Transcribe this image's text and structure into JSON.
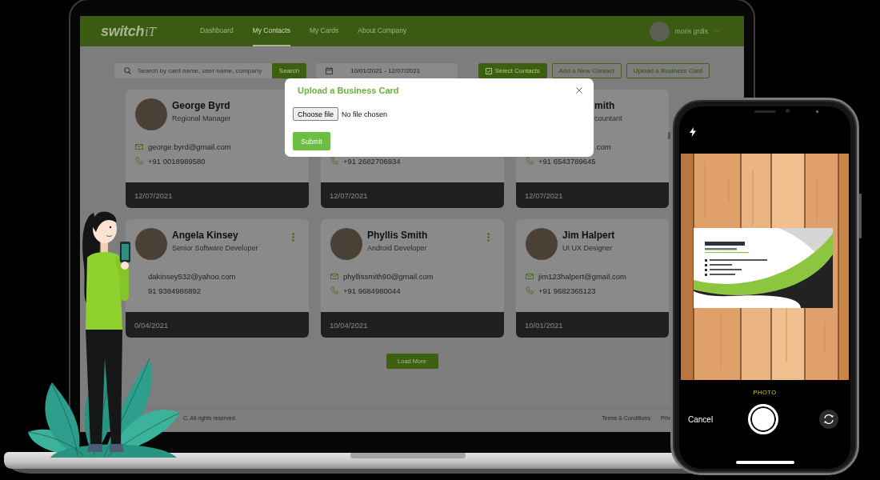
{
  "app": {
    "nav": {
      "logo": {
        "text": "switch",
        "script": "iT"
      },
      "items": [
        {
          "label": "Dashboard",
          "selected": false
        },
        {
          "label": "My Contacts",
          "selected": true
        },
        {
          "label": "My Cards",
          "selected": false
        },
        {
          "label": "About Company",
          "selected": false
        }
      ],
      "user": {
        "name": "moris grdis"
      }
    },
    "toolbar": {
      "search": {
        "placeholder": "Search by card name, user name, company",
        "button": "Search"
      },
      "date_range": {
        "value": "10/01/2021 - 12/07/2021"
      },
      "buttons": [
        {
          "label": "Select Contacts",
          "kind": "filled",
          "icon": true
        },
        {
          "label": "Add a New Contact",
          "kind": "outline",
          "icon": false
        },
        {
          "label": "Upload a Business Card",
          "kind": "outline",
          "icon": false
        }
      ]
    },
    "contacts": [
      {
        "name": "George Byrd",
        "title": "Regional Manager",
        "photo": true,
        "menu": false,
        "email": {
          "text": "george.byrd@gmail.com",
          "icon": true
        },
        "phone": {
          "text": "+91 0018989580",
          "icon": true
        },
        "date": "12/07/2021"
      },
      {
        "photo": false,
        "menu": false,
        "phone": {
          "text": "+91 2682706934",
          "icon": true
        },
        "date": "12/07/2021"
      },
      {
        "name": "mith",
        "title": "countant",
        "photo": false,
        "menu": false,
        "email": {
          "text": ".com",
          "icon": false
        },
        "phone": {
          "text": "+91 6543789645",
          "icon": true
        },
        "date": "12/07/2021"
      },
      {
        "name": "Angela Kinsey",
        "title": "Senior Software Developer",
        "photo": true,
        "menu": true,
        "email": {
          "text": "dakinsey532@yahoo.com",
          "icon": false
        },
        "phone": {
          "text": "91 9384986892",
          "icon": false
        },
        "date": "0/04/2021"
      },
      {
        "name": "Phyllis Smith",
        "title": "Android Developer",
        "photo": true,
        "menu": true,
        "email": {
          "text": "phyllissmith90@gmail.com",
          "icon": true
        },
        "phone": {
          "text": "+91 9684980044",
          "icon": true
        },
        "date": "10/04/2021"
      },
      {
        "name": "Jim Halpert",
        "title": "UI UX Designer",
        "photo": true,
        "menu": false,
        "email": {
          "text": "jim123halpert@gmail.com",
          "icon": true
        },
        "phone": {
          "text": "+91 9682365123",
          "icon": true
        },
        "date": "10/01/2021"
      }
    ],
    "load_more": "Load More",
    "footer": {
      "copyright": "C. All rights reserved.",
      "links": [
        "Terms & Conditions",
        "Priv"
      ]
    },
    "modal": {
      "title": "Upload a Business Card",
      "file_button": "Choose file",
      "file_status": "No file chosen",
      "submit": "Submit"
    }
  },
  "phone_camera": {
    "mode": "PHOTO",
    "cancel": "Cancel"
  }
}
